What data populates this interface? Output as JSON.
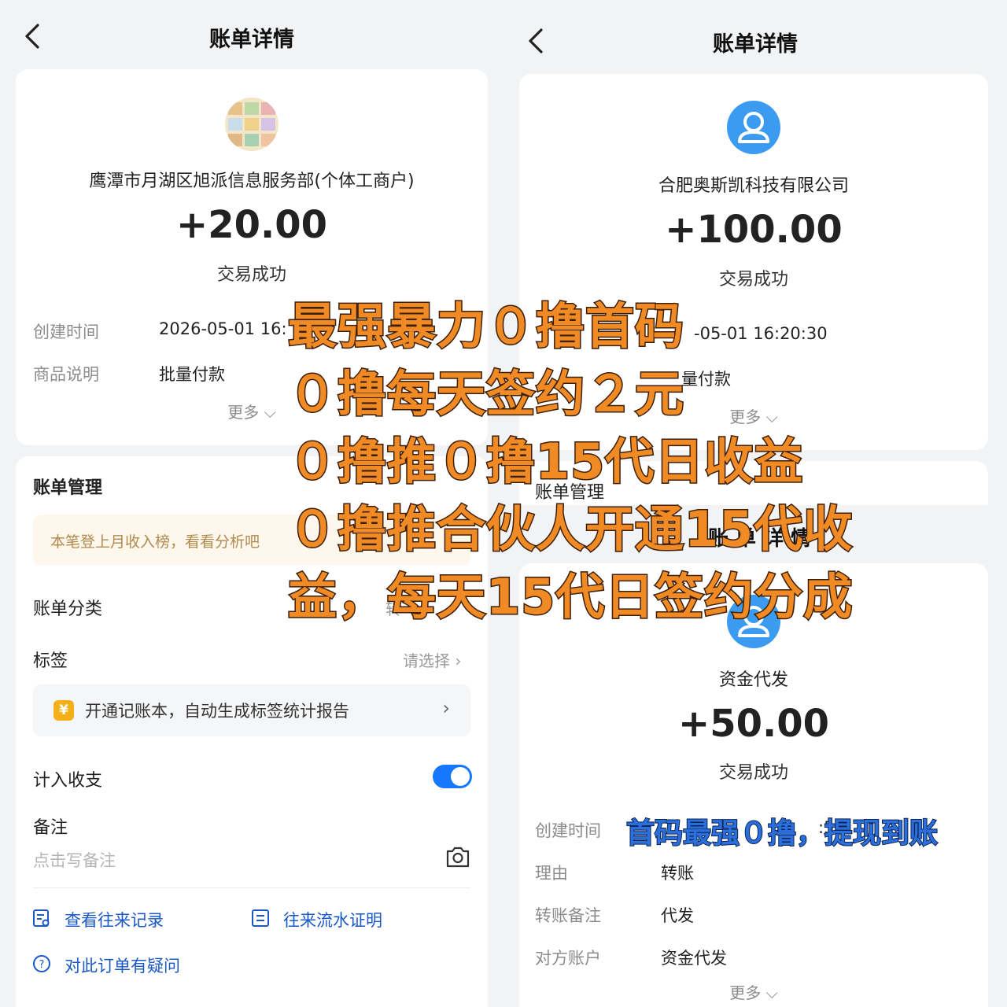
{
  "left": {
    "nav": {
      "title": "账单详情"
    },
    "detail": {
      "merchant": "鹰潭市月湖区旭派信息服务部(个体工商户)",
      "amount": "+20.00",
      "status": "交易成功",
      "rows": [
        {
          "label": "创建时间",
          "value": "2026-05-01 16:"
        },
        {
          "label": "商品说明",
          "value": "批量付款"
        }
      ],
      "more": "更多 ⌵"
    },
    "management": {
      "title": "账单管理",
      "banner": "本笔登上月收入榜，看看分析吧",
      "category_label": "账单分类",
      "category_value": "转",
      "tag_label": "标签",
      "tag_value": "请选择 ›",
      "promo": {
        "icon": "¥",
        "text": "开通记账本，自动生成标签统计报告",
        "chevron": "›"
      },
      "include_label": "计入收支",
      "include_on": true,
      "note_label": "备注",
      "note_placeholder": "点击写备注",
      "links": {
        "history": "查看往来记录",
        "proof": "往来流水证明",
        "question": "对此订单有疑问"
      }
    }
  },
  "right": {
    "nav": {
      "title": "账单详情"
    },
    "detail1": {
      "merchant": "合肥奥斯凯科技有限公司",
      "amount": "+100.00",
      "status": "交易成功",
      "time_value": "-05-01 16:20:30",
      "desc_value": "量付款",
      "more": "更多 ⌵"
    },
    "mgmt_partial": "账单管理",
    "hidden_title_fragment": "账 单 详 情",
    "detail2": {
      "merchant": "资金代发",
      "amount": "+50.00",
      "status": "交易成功",
      "rows": [
        {
          "label": "创建时间",
          "value": ":50"
        },
        {
          "label": "理由",
          "value": "转账"
        },
        {
          "label": "转账备注",
          "value": "代发"
        },
        {
          "label": "对方账户",
          "value": "资金代发"
        }
      ],
      "more": "更多 ⌵"
    }
  },
  "overlay": {
    "lines": [
      "最强暴力０撸首码",
      "０撸每天签约２元",
      "０撸推０撸15代日收益",
      "０撸推合伙人开通15代收",
      "益，每天15代日签约分成"
    ],
    "footer": "首码最强０撸，提现到账"
  },
  "colors": {
    "toggle": "#1677ff",
    "link": "#1a58c7",
    "overlay_orange": "#f08a24",
    "overlay_blue": "#2b6fdc",
    "avatar_blue": "#3a9bf0"
  }
}
